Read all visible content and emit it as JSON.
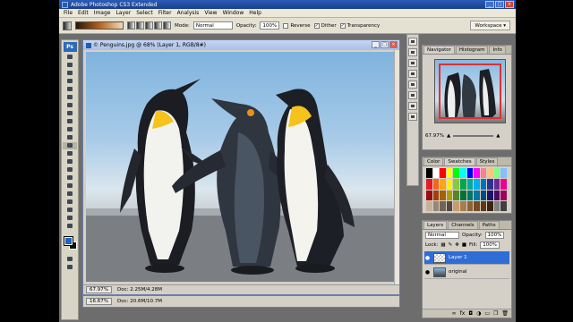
{
  "window": {
    "title": "Adobe Photoshop CS3 Extended"
  },
  "menu": [
    "File",
    "Edit",
    "Image",
    "Layer",
    "Select",
    "Filter",
    "Analysis",
    "View",
    "Window",
    "Help"
  ],
  "options": {
    "mode_label": "Mode:",
    "mode_value": "Normal",
    "opacity_label": "Opacity:",
    "opacity_value": "100%",
    "reverse_label": "Reverse",
    "dither_label": "Dither",
    "transparency_label": "Transparency",
    "workspace_label": "Workspace"
  },
  "toolbox": {
    "logo": "Ps"
  },
  "document": {
    "title": "© Penguins.jpg @ 68% (Layer 1, RGB/8#)",
    "zoom": "67.97%",
    "doc_size": "Doc: 2.25M/4.28M"
  },
  "document_back": {
    "zoom": "16.67%",
    "doc_size": "Doc: 20.6M/10.7M"
  },
  "navigator": {
    "tabs": [
      "Navigator",
      "Histogram",
      "Info"
    ],
    "zoom": "67.97%"
  },
  "swatches": {
    "tabs": [
      "Color",
      "Swatches",
      "Styles"
    ],
    "colors": [
      "#000000",
      "#ffffff",
      "#ff0000",
      "#ffff00",
      "#00ff00",
      "#00ffff",
      "#0000ff",
      "#ff00ff",
      "#ff8080",
      "#ffc080",
      "#80ff80",
      "#80c0ff",
      "#e31c24",
      "#f2671d",
      "#faa61a",
      "#fff200",
      "#8dc63f",
      "#00a651",
      "#00a99d",
      "#00aeef",
      "#0072bc",
      "#2e3192",
      "#662d91",
      "#ec008c",
      "#9e0b0f",
      "#a0410d",
      "#a36209",
      "#aba000",
      "#598527",
      "#007236",
      "#00746b",
      "#0076a3",
      "#004a80",
      "#1b1464",
      "#440e62",
      "#9e005d",
      "#c7b299",
      "#998675",
      "#736357",
      "#534741",
      "#c69c6d",
      "#a67c52",
      "#8c6239",
      "#754c24",
      "#603913",
      "#3c2415",
      "#808080",
      "#404040"
    ]
  },
  "layers": {
    "tabs": [
      "Layers",
      "Channels",
      "Paths"
    ],
    "blend_mode": "Normal",
    "opacity_label": "Opacity:",
    "opacity_value": "100%",
    "lock_label": "Lock:",
    "fill_label": "Fill:",
    "fill_value": "100%",
    "items": [
      {
        "name": "Layer 1"
      },
      {
        "name": "original"
      }
    ]
  }
}
